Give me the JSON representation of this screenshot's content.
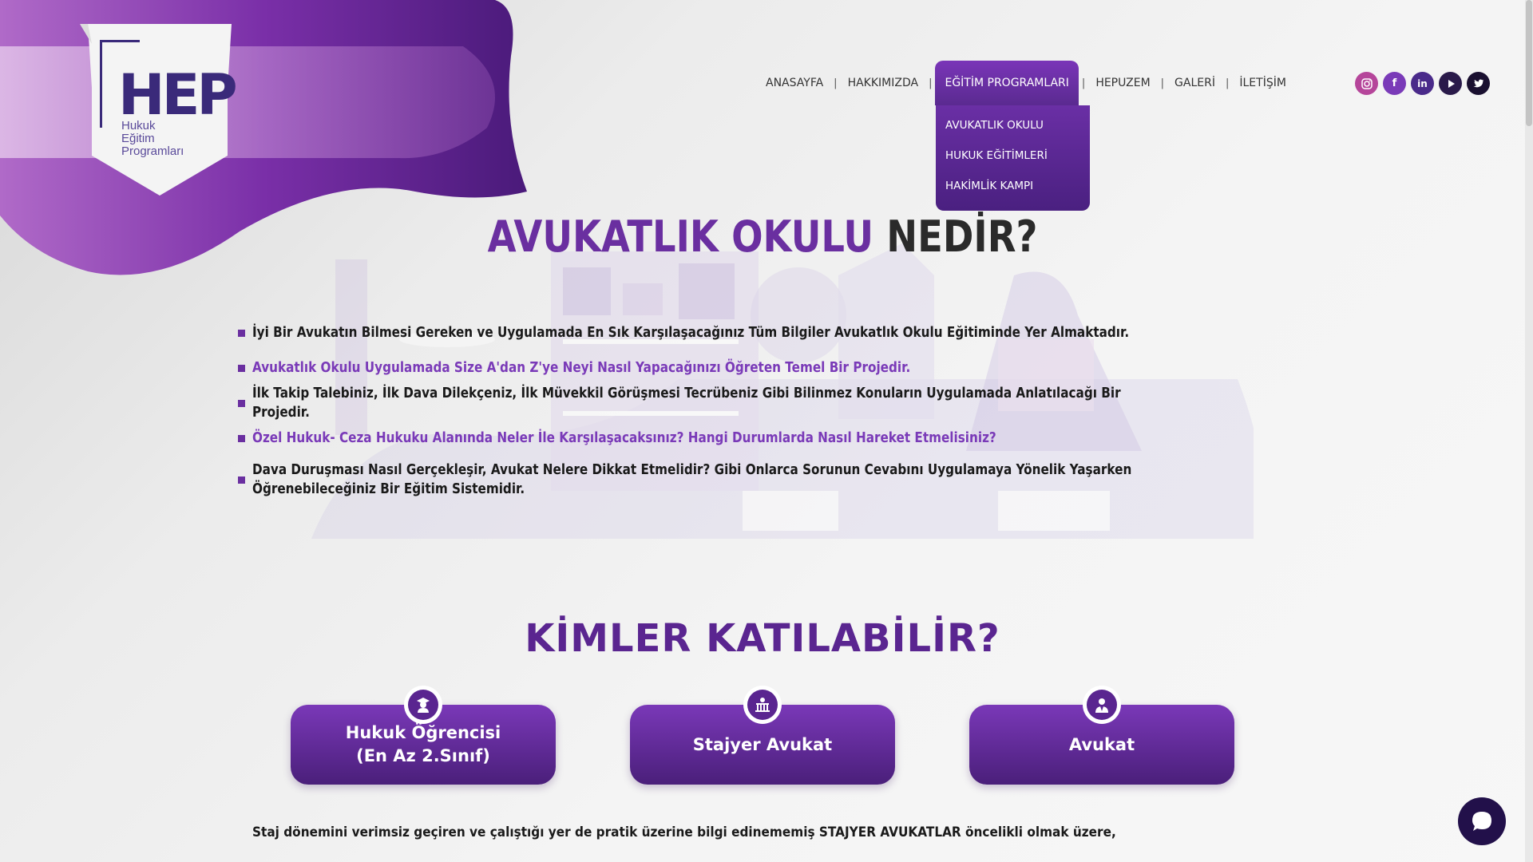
{
  "logo": {
    "mark": "HEP",
    "subtitle": "Hukuk\nEğitim\nProgramları"
  },
  "nav": {
    "items": [
      "ANASAYFA",
      "HAKKIMIZDA",
      "EĞİTİM PROGRAMLARI",
      "HEPUZEM",
      "GALERİ",
      "İLETİŞİM"
    ],
    "active": "EĞİTİM PROGRAMLARI",
    "dropdown": [
      "AVUKATLIK OKULU",
      "HUKUK EĞİTİMLERİ",
      "HAKİMLİK KAMPI"
    ]
  },
  "socials": [
    "instagram-icon",
    "facebook-icon",
    "linkedin-icon",
    "youtube-icon",
    "twitter-icon"
  ],
  "colors": {
    "accent": "#6a2fa0",
    "dark": "#2a2a2a",
    "instagram": "#b5459a",
    "facebook": "#7a3ab8",
    "linkedin": "#4a2a8a",
    "youtube": "#2a1a4a",
    "twitter": "#1a1030"
  },
  "main": {
    "title_part1": "AVUKATLIK OKULU",
    "title_part2": "NEDİR?",
    "bullets": [
      "İyi Bir Avukatın Bilmesi Gereken ve Uygulamada En Sık Karşılaşacağınız Tüm Bilgiler Avukatlık Okulu Eğitiminde Yer Almaktadır.",
      "Avukatlık Okulu Uygulamada Size A'dan Z'ye Neyi Nasıl Yapacağınızı Öğreten Temel Bir Projedir.",
      "İlk Takip Talebiniz, İlk Dava Dilekçeniz, İlk Müvekkil Görüşmesi Tecrübeniz Gibi Bilinmez Konuların Uygulamada Anlatılacağı Bir Projedir.",
      "Özel Hukuk- Ceza Hukuku Alanında Neler İle Karşılaşacaksınız? Hangi Durumlarda Nasıl Hareket Etmelisiniz?",
      "Dava Duruşması Nasıl Gerçekleşir, Avukat Nelere Dikkat Etmelidir? Gibi Onlarca Sorunun Cevabını Uygulamaya Yönelik Yaşarken Öğrenebileceğiniz Bir Eğitim Sistemidir."
    ]
  },
  "participants": {
    "title": "KİMLER KATILABİLİR?",
    "cards": [
      "Hukuk Öğrencisi\n(En Az 2.Sınıf)",
      "Stajyer Avukat",
      "Avukat"
    ]
  },
  "bottom_text": "Staj dönemini verimsiz geçiren ve çalıştığı yer de pratik üzerine bilgi edinememiş STAJYER AVUKATLAR öncelikli olmak üzere,"
}
